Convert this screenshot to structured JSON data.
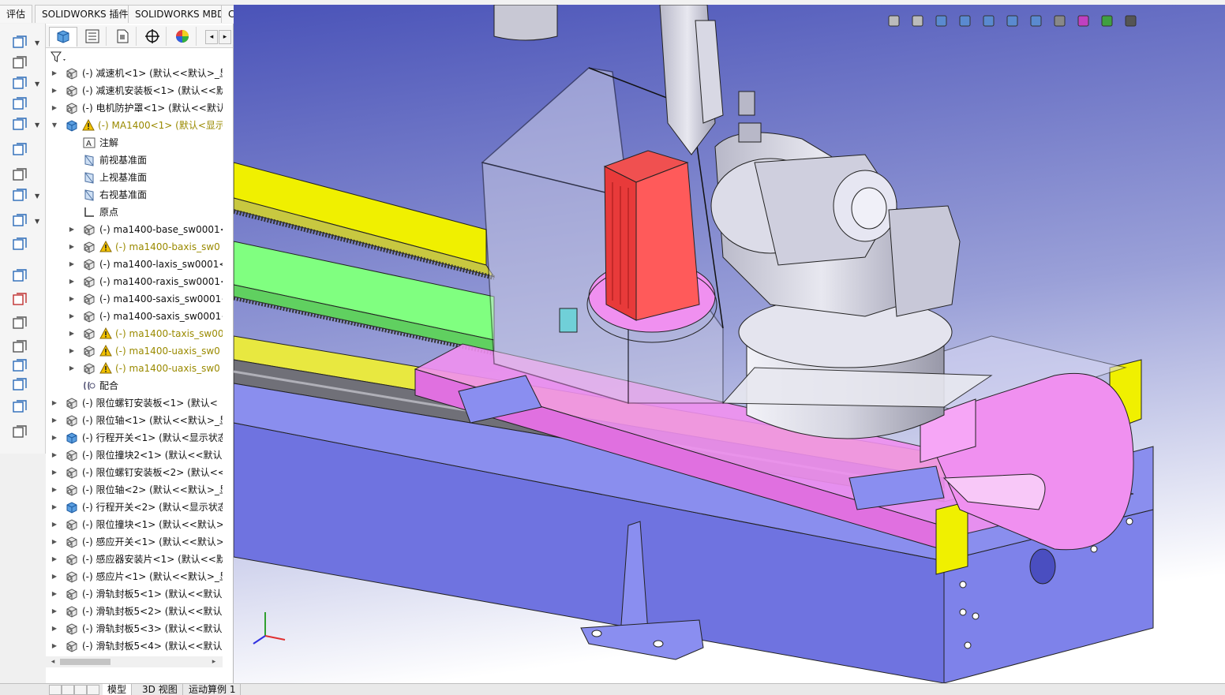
{
  "ribbon": {
    "tabs": [
      "评估",
      "SOLIDWORKS 插件",
      "SOLIDWORKS MBD",
      "CircuitWorks"
    ]
  },
  "left_toolbar": {
    "icons": [
      "assembly-insert-icon",
      "paperclip-icon",
      "pattern-icon",
      "edit-component-icon",
      "move-component-icon",
      "rotate-component-icon",
      "smart-fasteners-icon",
      "explode-view-icon",
      "interference-icon",
      "bom-icon",
      "mate-icon",
      "hole-series-icon",
      "exploded-line-icon",
      "instant3d-icon",
      "rebuild-icon",
      "measure-icon",
      "section-icon",
      "ruler-icon"
    ]
  },
  "feature_manager": {
    "panel_tabs": [
      "featuremanager-tab",
      "propertymanager-tab",
      "configurationmanager-tab",
      "dimxpert-tab",
      "display-manager-tab"
    ],
    "tree": [
      {
        "label": "(-) 减速机<1> (默认<<默认>_显",
        "level": 0,
        "icon": "part",
        "warn": false
      },
      {
        "label": "(-) 减速机安装板<1> (默认<<默",
        "level": 0,
        "icon": "part",
        "warn": false
      },
      {
        "label": "(-) 电机防护罩<1> (默认<<默认",
        "level": 0,
        "icon": "part",
        "warn": false
      },
      {
        "label": "(-) MA1400<1> (默认<显示",
        "level": 0,
        "icon": "assembly",
        "warn": true,
        "expanded": true
      },
      {
        "label": "注解",
        "level": 1,
        "icon": "annotation",
        "warn": false,
        "noarrow": true
      },
      {
        "label": "前视基准面",
        "level": 1,
        "icon": "plane",
        "warn": false,
        "noarrow": true
      },
      {
        "label": "上视基准面",
        "level": 1,
        "icon": "plane",
        "warn": false,
        "noarrow": true
      },
      {
        "label": "右视基准面",
        "level": 1,
        "icon": "plane",
        "warn": false,
        "noarrow": true
      },
      {
        "label": "原点",
        "level": 1,
        "icon": "origin",
        "warn": false,
        "noarrow": true
      },
      {
        "label": "(-) ma1400-base_sw0001<",
        "level": 1,
        "icon": "part",
        "warn": false
      },
      {
        "label": "(-) ma1400-baxis_sw0",
        "level": 1,
        "icon": "part",
        "warn": true
      },
      {
        "label": "(-) ma1400-laxis_sw0001<",
        "level": 1,
        "icon": "part",
        "warn": false
      },
      {
        "label": "(-) ma1400-raxis_sw0001<",
        "level": 1,
        "icon": "part",
        "warn": false
      },
      {
        "label": "(-) ma1400-saxis_sw0001<",
        "level": 1,
        "icon": "part",
        "warn": false
      },
      {
        "label": "(-) ma1400-saxis_sw0001<",
        "level": 1,
        "icon": "part",
        "warn": false
      },
      {
        "label": "(-) ma1400-taxis_sw00",
        "level": 1,
        "icon": "part",
        "warn": true
      },
      {
        "label": "(-) ma1400-uaxis_sw0",
        "level": 1,
        "icon": "part",
        "warn": true
      },
      {
        "label": "(-) ma1400-uaxis_sw0",
        "level": 1,
        "icon": "part",
        "warn": true
      },
      {
        "label": "配合",
        "level": 1,
        "icon": "mates",
        "warn": false,
        "noarrow": true
      },
      {
        "label": "(-) 限位螺钉安装板<1> (默认<",
        "level": 0,
        "icon": "part",
        "warn": false
      },
      {
        "label": "(-) 限位轴<1> (默认<<默认>_显",
        "level": 0,
        "icon": "part",
        "warn": false
      },
      {
        "label": "(-) 行程开关<1> (默认<显示状态",
        "level": 0,
        "icon": "assembly",
        "warn": false
      },
      {
        "label": "(-) 限位撞块2<1> (默认<<默认",
        "level": 0,
        "icon": "part",
        "warn": false
      },
      {
        "label": "(-) 限位螺钉安装板<2> (默认<<",
        "level": 0,
        "icon": "part",
        "warn": false
      },
      {
        "label": "(-) 限位轴<2> (默认<<默认>_显",
        "level": 0,
        "icon": "part",
        "warn": false
      },
      {
        "label": "(-) 行程开关<2> (默认<显示状态",
        "level": 0,
        "icon": "assembly",
        "warn": false
      },
      {
        "label": "(-) 限位撞块<1> (默认<<默认>",
        "level": 0,
        "icon": "part",
        "warn": false
      },
      {
        "label": "(-) 感应开关<1> (默认<<默认>",
        "level": 0,
        "icon": "part",
        "warn": false
      },
      {
        "label": "(-) 感应器安装片<1> (默认<<默",
        "level": 0,
        "icon": "part",
        "warn": false
      },
      {
        "label": "(-) 感应片<1> (默认<<默认>_显",
        "level": 0,
        "icon": "part",
        "warn": false
      },
      {
        "label": "(-) 滑轨封板5<1> (默认<<默认",
        "level": 0,
        "icon": "part",
        "warn": false
      },
      {
        "label": "(-) 滑轨封板5<2> (默认<<默认",
        "level": 0,
        "icon": "part",
        "warn": false
      },
      {
        "label": "(-) 滑轨封板5<3> (默认<<默认",
        "level": 0,
        "icon": "part",
        "warn": false
      },
      {
        "label": "(-) 滑轨封板5<4> (默认<<默认",
        "level": 0,
        "icon": "part",
        "warn": false
      }
    ]
  },
  "bottom_tabs": [
    "模型",
    "3D 视图",
    "运动算例 1"
  ],
  "heads_up_toolbar": [
    "zoom-to-fit-icon",
    "zoom-area-icon",
    "previous-view-icon",
    "section-view-icon",
    "dynamic-annotation-icon",
    "view-orientation-icon",
    "display-style-icon",
    "hide-show-icon",
    "edit-appearance-icon",
    "apply-scene-icon",
    "view-settings-icon"
  ],
  "colors": {
    "viewport_top": "#4a53b8",
    "viewport_bottom": "#ffffff",
    "base_frame": "#6f73e0",
    "rail_yellow": "#f0f000",
    "magenta": "#f090f0",
    "green": "#80ff80",
    "red_motor": "#e83a3a",
    "robot_gray": "#dcdce6",
    "warning": "#f2c200"
  }
}
